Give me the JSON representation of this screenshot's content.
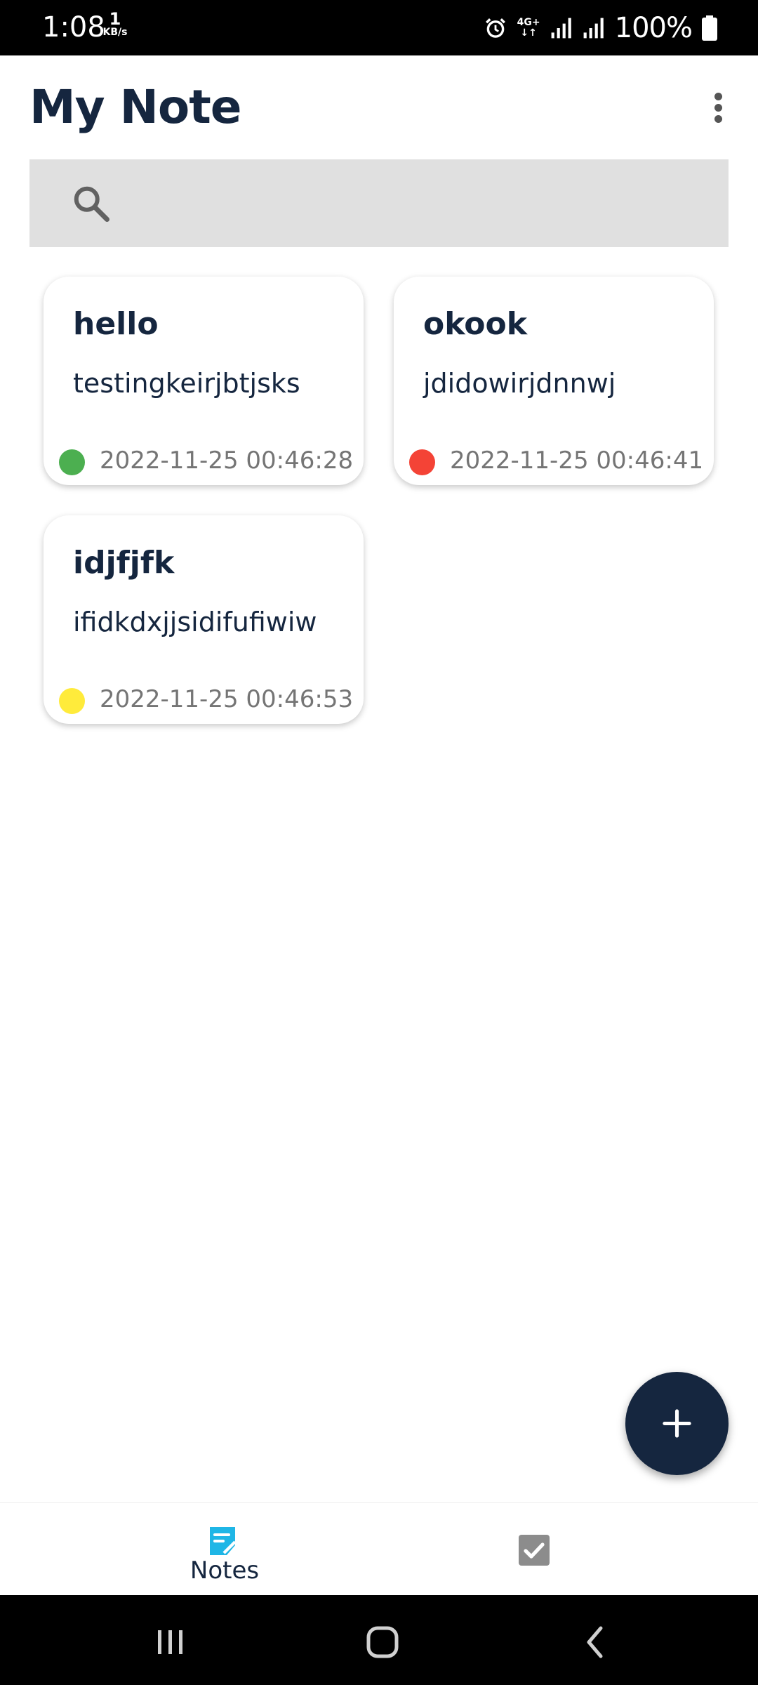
{
  "status_bar": {
    "time": "1:08",
    "speed_value": "1",
    "speed_unit": "KB/s",
    "network_label": "4G+",
    "battery": "100%",
    "icons": [
      "alarm-icon",
      "network-4g-icon",
      "signal-icon",
      "signal-icon",
      "battery-icon"
    ]
  },
  "header": {
    "title": "My Note",
    "menu_icon": "more-vert-icon"
  },
  "search": {
    "icon": "search-icon",
    "value": "",
    "placeholder": ""
  },
  "notes": [
    {
      "title": "hello",
      "body": "testingkeirjbtjsks",
      "date": "2022-11-25 00:46:28",
      "color": "#4caf50"
    },
    {
      "title": "okook",
      "body": "jdidowirjdnnwj",
      "date": "2022-11-25 00:46:41",
      "color": "#f44336"
    },
    {
      "title": "idjfjfk",
      "body": "ifidkdxjjsidifufiwiw",
      "date": "2022-11-25 00:46:53",
      "color": "#ffeb3b"
    }
  ],
  "fab": {
    "icon": "plus-icon",
    "color": "#15263f"
  },
  "bottom_nav": {
    "notes_label": "Notes",
    "notes_icon": "note-icon",
    "notes_icon_color": "#1fb6e6",
    "tasks_icon": "checkbox-icon"
  },
  "system_nav": {
    "buttons": [
      "recent-apps-icon",
      "home-icon",
      "back-icon"
    ]
  },
  "colors": {
    "primary": "#15263f",
    "search_bg": "#e0e0e0",
    "date_text": "#757575"
  }
}
